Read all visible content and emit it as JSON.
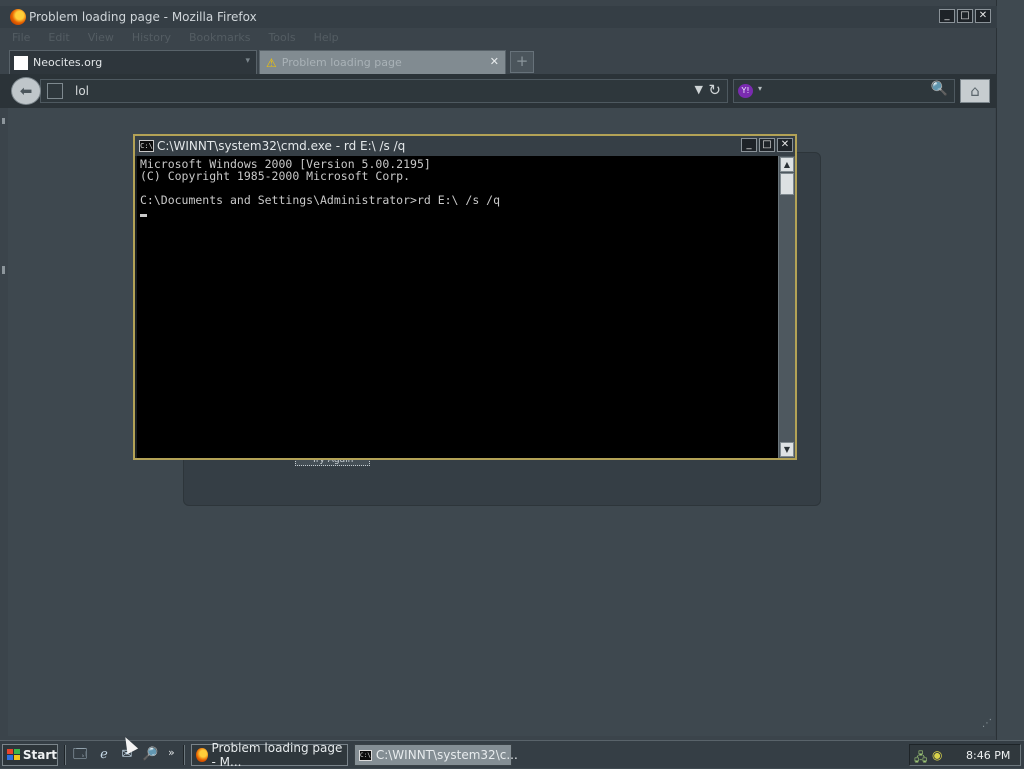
{
  "firefox": {
    "title": "Problem loading page - Mozilla Firefox",
    "menu": [
      "File",
      "Edit",
      "View",
      "History",
      "Bookmarks",
      "Tools",
      "Help"
    ],
    "tabs": [
      {
        "label": "Neocites.org"
      },
      {
        "label": "Problem loading page"
      }
    ],
    "url": "lol",
    "search_placeholder": "",
    "error_panel": {
      "try_again_label": "Try Again"
    }
  },
  "cmd": {
    "title": "C:\\WINNT\\system32\\cmd.exe - rd E:\\ /s /q",
    "icon_text": "C:\\",
    "lines": [
      "Microsoft Windows 2000 [Version 5.00.2195]",
      "(C) Copyright 1985-2000 Microsoft Corp.",
      "",
      "C:\\Documents and Settings\\Administrator>rd E:\\ /s /q"
    ]
  },
  "taskbar": {
    "start_label": "Start",
    "tasks": [
      {
        "label": "Problem loading page - M..."
      },
      {
        "label": "C:\\WINNT\\system32\\c..."
      }
    ],
    "clock": "8:46 PM",
    "quick_launch_more": "»"
  },
  "icons": {
    "firefox": "firefox-icon",
    "warning": "warning-icon",
    "close": "close-icon",
    "new_tab": "plus-icon",
    "back": "back-arrow-icon",
    "reload": "reload-icon",
    "search": "magnifier-icon",
    "home": "home-icon"
  },
  "colors": {
    "cmd_border": "#b3a256",
    "warning": "#f3c400",
    "firefox_chrome": "#353e45"
  }
}
